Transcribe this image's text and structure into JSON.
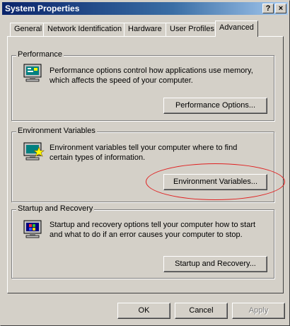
{
  "window": {
    "title": "System Properties",
    "help_button": "?",
    "close_button": "×"
  },
  "tabs": [
    {
      "label": "General"
    },
    {
      "label": "Network Identification"
    },
    {
      "label": "Hardware"
    },
    {
      "label": "User Profiles"
    },
    {
      "label": "Advanced"
    }
  ],
  "groups": {
    "performance": {
      "label": "Performance",
      "text": "Performance options control how applications use memory, which affects the speed of your computer.",
      "button": "Performance Options..."
    },
    "environment": {
      "label": "Environment Variables",
      "text": "Environment variables tell your computer where to find certain types of information.",
      "button": "Environment Variables..."
    },
    "startup": {
      "label": "Startup and Recovery",
      "text": "Startup and recovery options tell your computer how to start and what to do if an error causes your computer to stop.",
      "button": "Startup and Recovery..."
    }
  },
  "footer": {
    "ok": "OK",
    "cancel": "Cancel",
    "apply": "Apply"
  },
  "colors": {
    "face": "#d4d0c8",
    "title_bar": "#0a246a",
    "annotation": "#e02020"
  }
}
